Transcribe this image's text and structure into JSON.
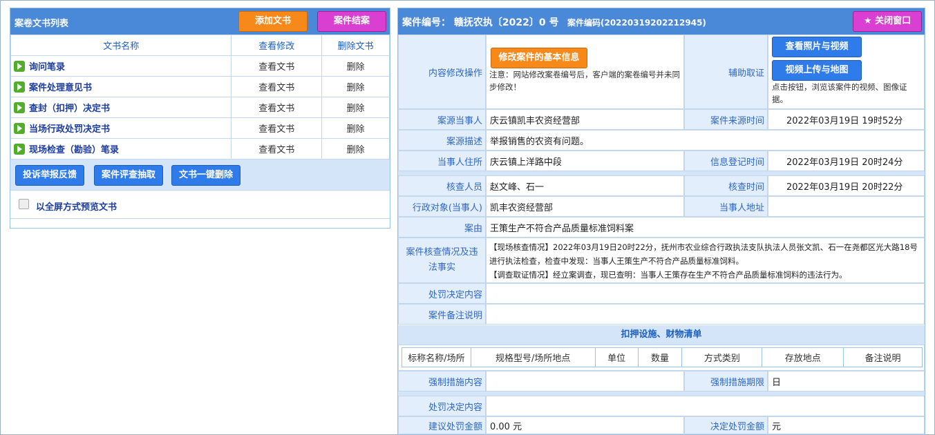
{
  "left": {
    "title": "案卷文书列表",
    "add_btn": "添加文书",
    "close_case_btn": "案件结案",
    "columns": [
      "文书名称",
      "查看修改",
      "删除文书"
    ],
    "docs": [
      {
        "name": "询问笔录",
        "view": "查看文书",
        "del": "删除"
      },
      {
        "name": "案件处理意见书",
        "view": "查看文书",
        "del": "删除"
      },
      {
        "name": "查封（扣押）决定书",
        "view": "查看文书",
        "del": "删除"
      },
      {
        "name": "当场行政处罚决定书",
        "view": "查看文书",
        "del": "删除"
      },
      {
        "name": "现场检查（勘验）笔录",
        "view": "查看文书",
        "del": "删除"
      }
    ],
    "tools": [
      "投诉举报反馈",
      "案件评查抽取",
      "文书一键删除"
    ],
    "fullscreen_label": "以全屏方式预览文书"
  },
  "right": {
    "case_no": "案件编号： 赣抚农执〔2022〕0 号",
    "case_code": "案件编码(20220319202212945)",
    "close_window": "★ 关闭窗口",
    "edit_label": "内容修改操作",
    "edit_btn": "修改案件的基本信息",
    "edit_note": "注意：网站修改案卷编号后，客户端的案卷编号并未同步修改！",
    "aux_label": "辅助取证",
    "photo_btn": "查看照片与视频",
    "upload_btn": "视频上传与地图",
    "aux_note": "点击按钮，浏览该案件的视频、图像证据。",
    "source_party_label": "案源当事人",
    "source_party": "庆云镇凯丰农资经营部",
    "source_time_label": "案件来源时间",
    "source_time": "2022年03月19日 19时52分",
    "source_desc_label": "案源描述",
    "source_desc": "举报销售的农资有问题。",
    "party_addr_label": "当事人住所",
    "party_addr": "庆云镇上洋路中段",
    "reg_time_label": "信息登记时间",
    "reg_time": "2022年03月19日 20时24分",
    "inspector_label": "核查人员",
    "inspector": "赵文峰、石一",
    "check_time_label": "核查时间",
    "check_time": "2022年03月19日 20时22分",
    "target_label": "行政对象(当事人)",
    "target": "凯丰农资经营部",
    "target_addr_label": "当事人地址",
    "target_addr": "",
    "cause_label": "案由",
    "cause": "王策生产不符合产品质量标准饲料案",
    "facts_label": "案件核查情况及违法事实",
    "facts_1": "【现场核查情况】2022年03月19日20时22分，抚州市农业综合行政执法支队执法人员张文凯、石一在尧都区光大路18号进行执法检查，检查中发现：当事人王策生产不符合产品质量标准饲料。",
    "facts_2": "【调查取证情况】经立案调查，现已查明：当事人王策存在生产不符合产品质量标准饲料的违法行为。",
    "penalty_content_label": "处罚决定内容",
    "penalty_content": "",
    "remark_label": "案件备注说明",
    "remark": "",
    "seize_title": "扣押设施、财物清单",
    "seize_columns": [
      "标称名称/场所",
      "规格型号/场所地点",
      "单位",
      "数量",
      "方式类别",
      "存放地点",
      "备注说明"
    ],
    "force_content_label": "强制措施内容",
    "force_content": "",
    "force_limit_label": "强制措施期限",
    "force_limit": "日",
    "penalty_content2_label": "处罚决定内容",
    "penalty_content2": "",
    "suggest_amount_label": "建议处罚金额",
    "suggest_amount": "0.00 元",
    "decide_amount_label": "决定处罚金额",
    "decide_amount": "元"
  }
}
